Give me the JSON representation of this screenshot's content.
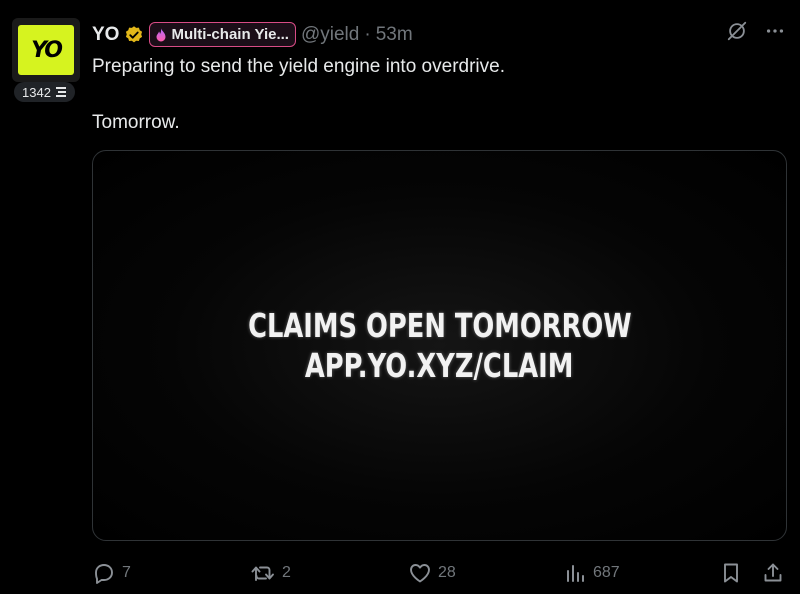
{
  "author": {
    "name": "YO",
    "avatar_text": "YO",
    "avatar_color": "#d6f31f",
    "level": "1342",
    "affiliate_label": "Multi-chain Yie...",
    "handle": "@yield",
    "separator": "·",
    "time": "53m"
  },
  "tweet": {
    "paragraphs": [
      "Preparing to send the yield engine into overdrive.",
      "Tomorrow."
    ]
  },
  "media": {
    "line1": "CLAIMS OPEN TOMORROW",
    "line2": "APP.YO.XYZ/CLAIM"
  },
  "actions": {
    "replies": "7",
    "reposts": "2",
    "likes": "28",
    "views": "687"
  },
  "icons": {
    "verified": "verified-gold-badge-icon",
    "affiliate": "affiliate-flame-icon",
    "grok": "grok-icon",
    "more": "more-icon",
    "reply": "reply-icon",
    "repost": "repost-icon",
    "like": "like-icon",
    "views": "views-icon",
    "bookmark": "bookmark-icon",
    "share": "share-icon"
  },
  "colors": {
    "background": "#000000",
    "text": "#e7e9ea",
    "muted": "#71767b",
    "verified_gold": "#e2b719",
    "affiliate_border": "#d84c86"
  }
}
